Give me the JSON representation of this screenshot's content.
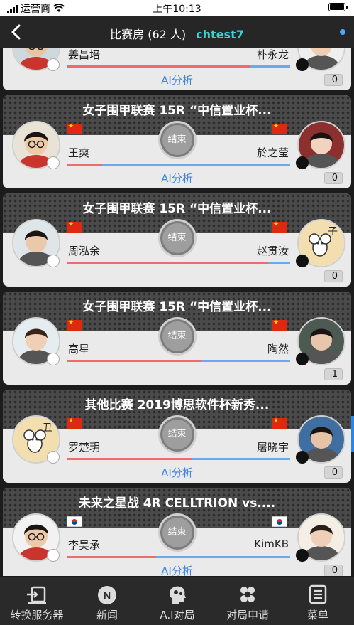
{
  "status_bar": {
    "carrier": "运营商",
    "time": "上午10:13"
  },
  "header": {
    "title": "比赛房 (62 人)",
    "username": "chtest7"
  },
  "games": [
    {
      "event": "",
      "left_player": "姜昌培",
      "right_player": "朴永龙",
      "status": "",
      "red_share": 0.82,
      "ai_label": "AI分析",
      "count": "0",
      "left_flag": "",
      "right_flag": ""
    },
    {
      "event": "女子围甲联赛   15R “中信置业杯...",
      "left_player": "王爽",
      "right_player": "於之莹",
      "status": "结束",
      "red_share": 0.16,
      "ai_label": "AI分析",
      "count": "0",
      "left_flag": "cn",
      "right_flag": "cn"
    },
    {
      "event": "女子围甲联赛   15R “中信置业杯...",
      "left_player": "周泓余",
      "right_player": "赵贯汝",
      "status": "结束",
      "red_share": 0.9,
      "ai_label": "",
      "count": "0",
      "left_flag": "cn",
      "right_flag": "cn"
    },
    {
      "event": "女子围甲联赛   15R “中信置业杯...",
      "left_player": "高星",
      "right_player": "陶然",
      "status": "结束",
      "red_share": 0.6,
      "ai_label": "",
      "count": "1",
      "left_flag": "cn",
      "right_flag": "cn"
    },
    {
      "event": "其他比赛   2019博思软件杯新秀...",
      "left_player": "罗楚玥",
      "right_player": "屠晓宇",
      "status": "结束",
      "red_share": 0.56,
      "ai_label": "AI分析",
      "count": "0",
      "left_flag": "cn",
      "right_flag": "cn"
    },
    {
      "event": "未来之星战   4R CELLTRION vs....",
      "left_player": "李昊承",
      "right_player": "KimKB",
      "status": "结束",
      "red_share": 0.4,
      "ai_label": "AI分析",
      "count": "0",
      "left_flag": "kr",
      "right_flag": "kr"
    }
  ],
  "tabbar": [
    {
      "label": "转换服务器",
      "icon": "switch-server-icon"
    },
    {
      "label": "新闻",
      "icon": "news-icon"
    },
    {
      "label": "A.I对局",
      "icon": "ai-brain-icon"
    },
    {
      "label": "对局申请",
      "icon": "game-request-icon"
    },
    {
      "label": "菜单",
      "icon": "menu-icon"
    }
  ],
  "colors": {
    "accent_cyan": "#37d3d3",
    "ai_blue": "#3d86e6",
    "red_bar": "#ef6b6b",
    "blue_bar": "#6aa9f0"
  }
}
